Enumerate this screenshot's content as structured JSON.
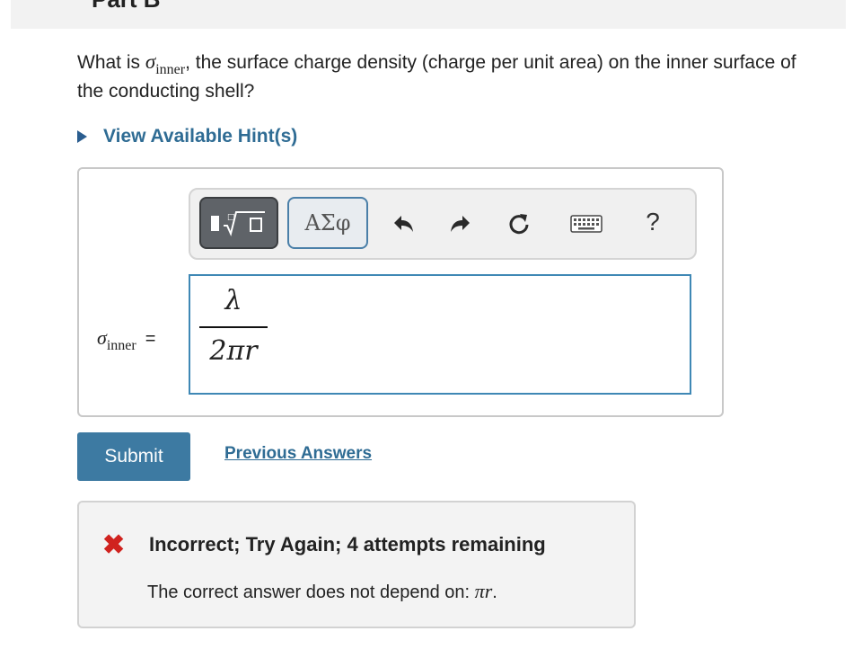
{
  "header": {
    "part_label": "Part B"
  },
  "question": {
    "prefix": "What is ",
    "symbol": "σ",
    "subscript": "inner",
    "suffix": ", the surface charge density (charge per unit area) on the inner surface of the conducting shell?"
  },
  "hint": {
    "label": "View Available Hint(s)"
  },
  "toolbar": {
    "templates_icon": "templates-radical-icon",
    "greek_label": "ΑΣφ",
    "undo_icon": "undo-icon",
    "redo_icon": "redo-icon",
    "reset_icon": "reset-icon",
    "keyboard_icon": "keyboard-icon",
    "help_label": "?"
  },
  "answer": {
    "symbol": "σ",
    "subscript": "inner",
    "equals": "=",
    "numerator": "λ",
    "denominator": "2πr"
  },
  "actions": {
    "submit_label": "Submit",
    "previous_answers_label": "Previous Answers"
  },
  "feedback": {
    "icon": "x-icon",
    "mark": "✖",
    "title": "Incorrect; Try Again; 4 attempts remaining",
    "detail_prefix": "The correct answer does not depend on: ",
    "detail_var": "πr",
    "detail_suffix": "."
  },
  "colors": {
    "link": "#2f6c94",
    "submit_bg": "#3d7aa2",
    "input_border": "#3f88b5",
    "error_red": "#d0231f"
  }
}
